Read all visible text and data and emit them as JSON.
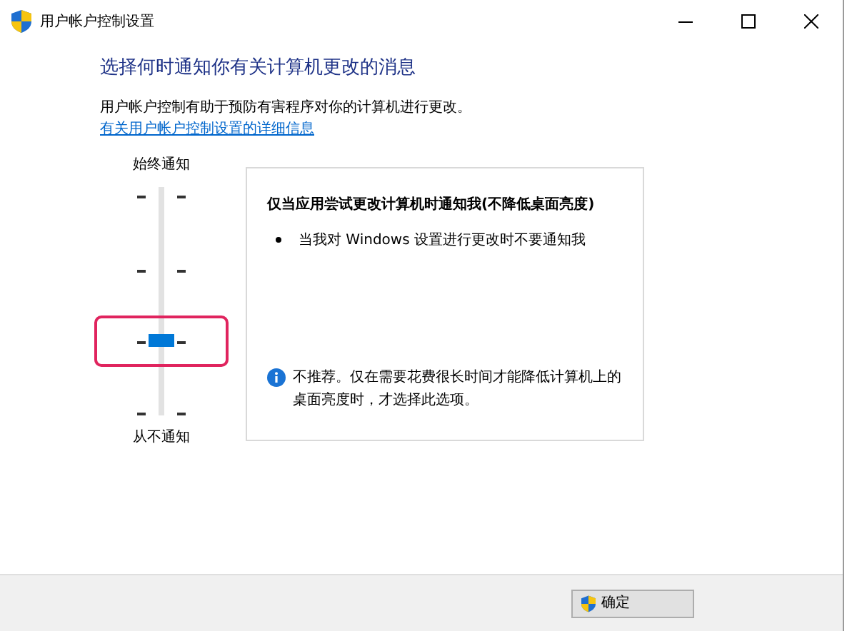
{
  "window": {
    "title": "用户帐户控制设置"
  },
  "heading": "选择何时通知你有关计算机更改的消息",
  "description": "用户帐户控制有助于预防有害程序对你的计算机进行更改。",
  "link": "有关用户帐户控制设置的详细信息",
  "slider": {
    "top_label": "始终通知",
    "bottom_label": "从不通知",
    "level": 0.333
  },
  "panel": {
    "title": "仅当应用尝试更改计算机时通知我(不降低桌面亮度)",
    "bullets": [
      "当我对 Windows 设置进行更改时不要通知我"
    ],
    "note": "不推荐。仅在需要花费很长时间才能降低计算机上的桌面亮度时，才选择此选项。"
  },
  "buttons": [
    "确定"
  ]
}
